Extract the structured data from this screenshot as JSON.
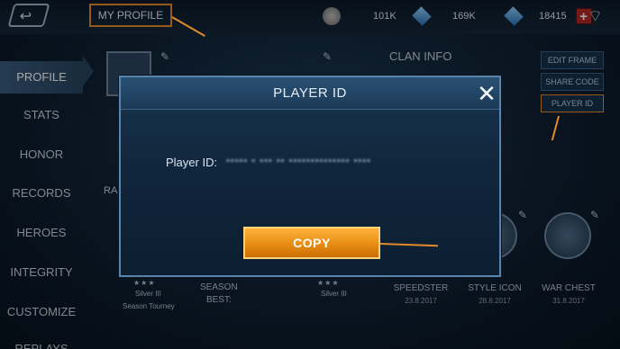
{
  "topbar": {
    "profile_label": "MY PROFILE",
    "coins": "101K",
    "tickets": "169K",
    "diamonds": "18415",
    "plus": "+",
    "back_icon": "↩"
  },
  "sidebar": {
    "items": [
      {
        "label": "PROFILE"
      },
      {
        "label": "STATS"
      },
      {
        "label": "HONOR"
      },
      {
        "label": "RECORDS"
      },
      {
        "label": "HEROES"
      },
      {
        "label": "INTEGRITY"
      },
      {
        "label": "CUSTOMIZE"
      },
      {
        "label": "REPLAYS"
      }
    ]
  },
  "profile": {
    "clan_info": "CLAN INFO",
    "ra_label": "RA",
    "season_best": "SEASON\nBEST:",
    "rank_left": "Silver III",
    "rank_left_sub": "Season Tourney",
    "rank_right": "Silver III",
    "buttons": [
      "EDIT FRAME",
      "SHARE CODE",
      "PLAYER ID"
    ],
    "achievements": [
      {
        "title": "SPEEDSTER",
        "date": "23.8.2017"
      },
      {
        "title": "STYLE ICON",
        "date": "28.8.2017"
      },
      {
        "title": "WAR CHEST",
        "date": "31.8.2017"
      }
    ]
  },
  "modal": {
    "title": "PLAYER ID",
    "close_icon": "✕",
    "label": "Player ID:",
    "value_masked": "•••••  •  •••  ••  ••••••••••••••  ••••",
    "copy_button": "COPY"
  },
  "colors": {
    "highlight": "#e38b2b",
    "copy_button": "#e88c12",
    "modal_border": "#5b84ad"
  }
}
